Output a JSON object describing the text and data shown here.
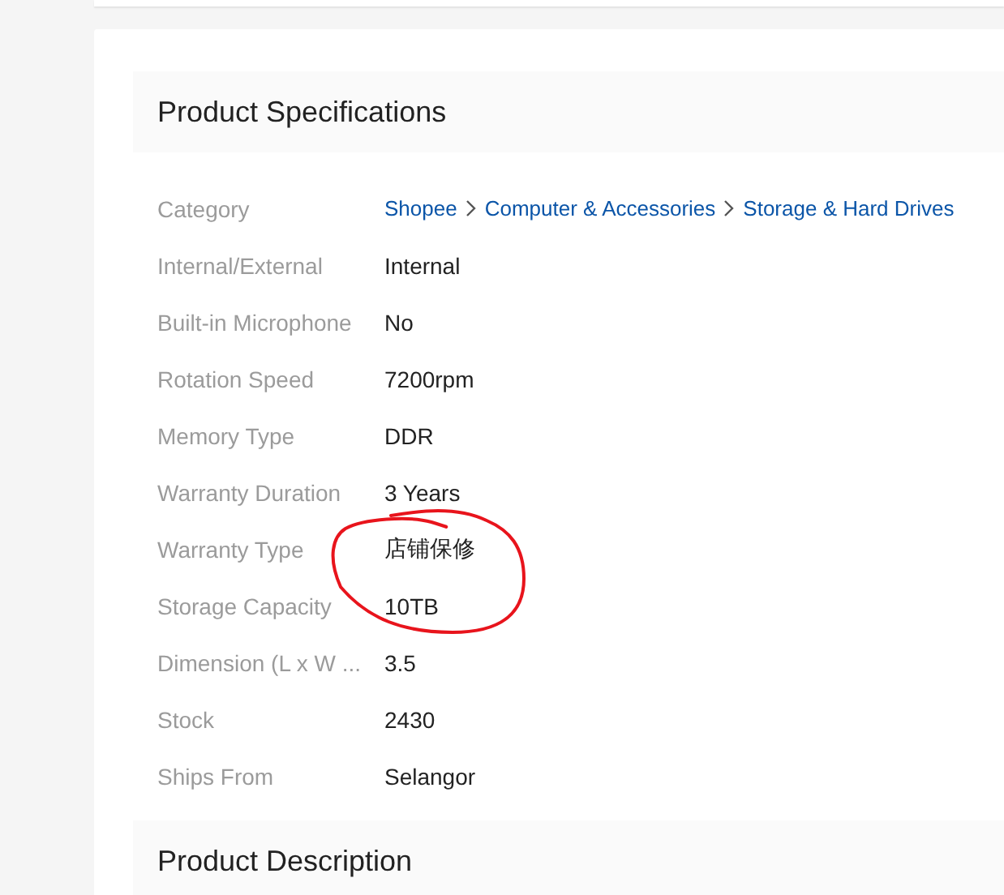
{
  "specifications": {
    "title": "Product Specifications",
    "rows": [
      {
        "label": "Category",
        "kind": "breadcrumb",
        "links": [
          "Shopee",
          "Computer & Accessories",
          "Storage & Hard Drives"
        ]
      },
      {
        "label": "Internal/External",
        "kind": "text",
        "value": "Internal"
      },
      {
        "label": "Built-in Microphone",
        "kind": "text",
        "value": "No"
      },
      {
        "label": "Rotation Speed",
        "kind": "text",
        "value": "7200rpm"
      },
      {
        "label": "Memory Type",
        "kind": "text",
        "value": "DDR"
      },
      {
        "label": "Warranty Duration",
        "kind": "text",
        "value": "3 Years"
      },
      {
        "label": "Warranty Type",
        "kind": "text",
        "value": "店铺保修"
      },
      {
        "label": "Storage Capacity",
        "kind": "text",
        "value": "10TB"
      },
      {
        "label": "Dimension (L x W ...",
        "kind": "text",
        "value": "3.5"
      },
      {
        "label": "Stock",
        "kind": "text",
        "value": "2430"
      },
      {
        "label": "Ships From",
        "kind": "text",
        "value": "Selangor"
      }
    ]
  },
  "description": {
    "title": "Product Description"
  }
}
